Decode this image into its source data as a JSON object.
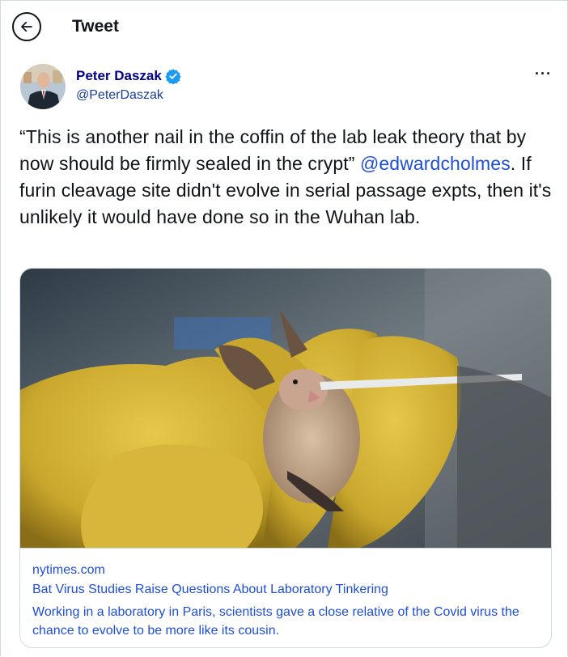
{
  "header": {
    "title": "Tweet"
  },
  "author": {
    "name": "Peter Daszak",
    "handle": "@PeterDaszak"
  },
  "tweet": {
    "text_before_mention": "“This is another nail in the coffin of the lab leak theory that by now should be firmly sealed in the crypt”",
    "mention": "@edwardcholmes",
    "text_after_mention": ". If furin cleavage site didn't evolve in serial passage expts, then it's unlikely it would have done so in the Wuhan lab."
  },
  "more_label": "···",
  "card": {
    "domain": "nytimes.com",
    "title": "Bat Virus Studies Raise Questions About Laboratory Tinkering",
    "description": "Working in a laboratory in Paris, scientists gave a close relative of the Covid virus the chance to evolve to be more like its cousin."
  },
  "colors": {
    "author_name": "#00008b",
    "link": "#1d4ed8",
    "verified": "#1d9bf0",
    "border": "#cfd9de"
  }
}
